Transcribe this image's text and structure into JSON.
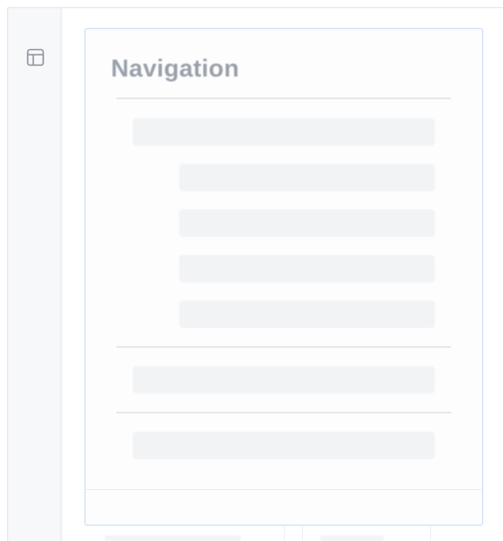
{
  "rail": {
    "icon": "layout-icon"
  },
  "panel": {
    "title": "Navigation",
    "groups": [
      {
        "items": [
          "",
          "",
          "",
          "",
          ""
        ]
      },
      {
        "items": [
          ""
        ]
      },
      {
        "items": [
          ""
        ]
      }
    ]
  },
  "colors": {
    "panel_border": "#cfe0f7",
    "title_text": "#9aa1ab",
    "placeholder": "#f2f3f5",
    "rail_bg": "#f7f8fa"
  }
}
